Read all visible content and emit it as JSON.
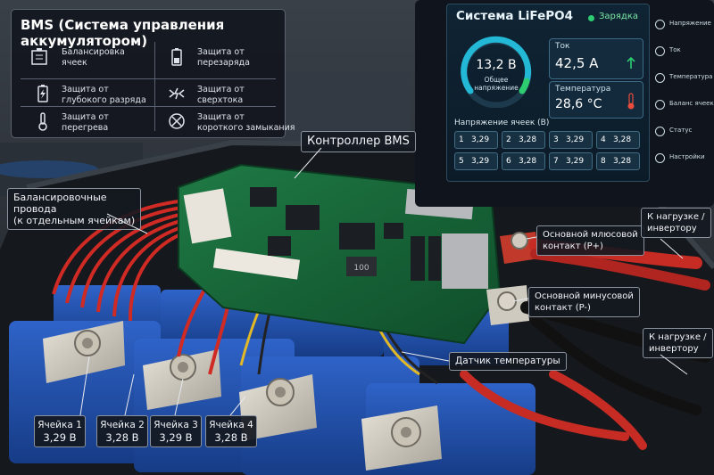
{
  "bms_panel": {
    "title": "BMS (Система управления аккумулятором)",
    "features": [
      {
        "icon": "battery-balance-icon",
        "label": "Балансировка\nячеек"
      },
      {
        "icon": "battery-overcharge-icon",
        "label": "Защита от\nперезаряда"
      },
      {
        "icon": "battery-deep-discharge-icon",
        "label": "Защита от\nглубокого разряда"
      },
      {
        "icon": "overcurrent-icon",
        "label": "Защита от\nсверхтока"
      },
      {
        "icon": "thermometer-icon",
        "label": "Защита от\nперегрева"
      },
      {
        "icon": "short-circuit-icon",
        "label": "Защита от\nкороткого замыкания"
      }
    ]
  },
  "monitor": {
    "title": "Система LiFePO4",
    "status": "Зарядка",
    "gauge_value": "13,2 В",
    "gauge_label": "Общее\nнапряжение",
    "current_label": "Ток",
    "current_value": "42,5 A",
    "temp_label": "Температура",
    "temp_value": "28,6 °C",
    "cells_title": "Напряжение ячеек (В)",
    "cells": [
      {
        "n": "1",
        "v": "3,29"
      },
      {
        "n": "2",
        "v": "3,28"
      },
      {
        "n": "3",
        "v": "3,29"
      },
      {
        "n": "4",
        "v": "3,28"
      },
      {
        "n": "5",
        "v": "3,29"
      },
      {
        "n": "6",
        "v": "3,28"
      },
      {
        "n": "7",
        "v": "3,29"
      },
      {
        "n": "8",
        "v": "3,28"
      }
    ],
    "sidebar": [
      {
        "icon": "voltage-icon",
        "label": "Напряжение"
      },
      {
        "icon": "current-icon",
        "label": "Ток"
      },
      {
        "icon": "temperature-icon",
        "label": "Температура"
      },
      {
        "icon": "balance-icon",
        "label": "Баланс ячеек"
      },
      {
        "icon": "status-icon",
        "label": "Статус"
      },
      {
        "icon": "settings-icon",
        "label": "Настройки"
      }
    ],
    "colors": {
      "accent": "#22b8d6",
      "ok": "#2ecc71",
      "warn": "#e74c3c"
    }
  },
  "labels": {
    "controller": "Контроллер BMS",
    "balance_wires": "Балансировочные\nпровода\n(к отдельным ячейкам)",
    "pos_contact": "Основной млюсовой\nконтакт (P+)",
    "neg_contact": "Основной минусовой\nконтакт (P-)",
    "load1": "К нагрузке /\nинвертору",
    "load2": "К нагрузке /\nинвертору",
    "temp_sensor": "Датчик температуры",
    "chip_marking": "100"
  },
  "cell_labels": [
    {
      "name": "Ячейка 1",
      "v": "3,29 В"
    },
    {
      "name": "Ячейка 2",
      "v": "3,28 В"
    },
    {
      "name": "Ячейка 3",
      "v": "3,29 В"
    },
    {
      "name": "Ячейка 4",
      "v": "3,28 В"
    }
  ]
}
